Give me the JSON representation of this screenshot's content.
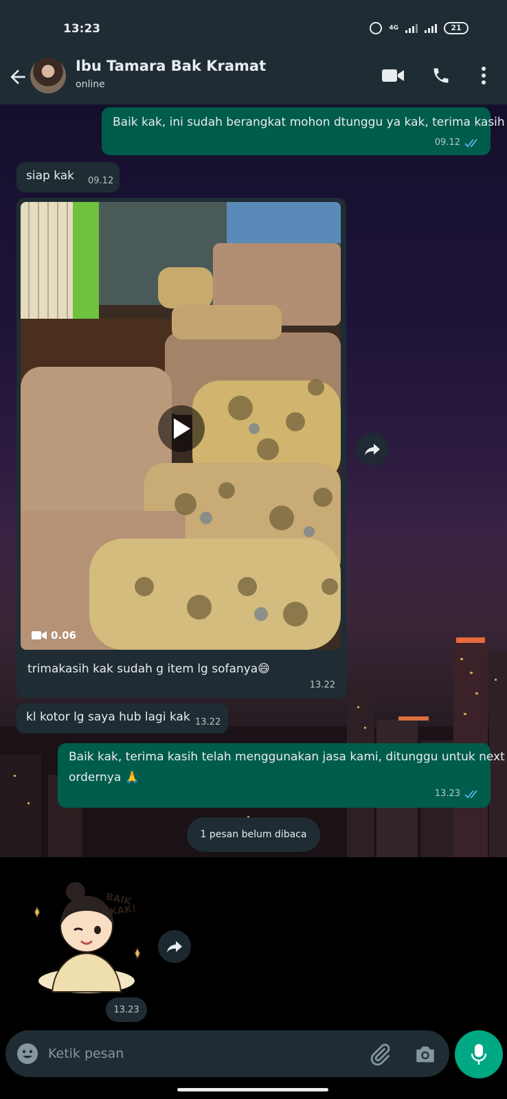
{
  "status_bar": {
    "time": "13:23",
    "network": "4G",
    "battery": "21"
  },
  "header": {
    "contact_name": "Ibu Tamara Bak Kramat",
    "contact_status": "online",
    "icons": [
      "back-arrow-icon",
      "video-call-icon",
      "voice-call-icon",
      "more-options-icon"
    ]
  },
  "messages": [
    {
      "direction": "out",
      "text": "Baik kak, ini sudah berangkat mohon dtunggu ya kak, terima kasih",
      "time": "09.12",
      "read": true
    },
    {
      "direction": "in",
      "text": "siap kak",
      "time": "09.12"
    },
    {
      "direction": "in",
      "type": "video",
      "duration": "0.06",
      "caption": "trimakasih kak sudah g item lg sofanya😄",
      "time": "13.22"
    },
    {
      "direction": "in",
      "text": "kl kotor lg saya hub lagi kak",
      "time": "13.22"
    },
    {
      "direction": "out",
      "text_line1": "Baik kak, terima kasih telah menggunakan jasa kami, ditunggu untuk next",
      "text_line2": "ordernya 🙏",
      "time": "13.23",
      "read": true
    },
    {
      "direction": "in",
      "type": "sticker",
      "sticker_text": "BAIK KAK!",
      "time": "13.23"
    }
  ],
  "unread_banner": "1 pesan belum dibaca",
  "composer": {
    "placeholder": "Ketik pesan"
  },
  "colors": {
    "outgoing": "#005c4b",
    "incoming": "#1f2c34",
    "accent": "#00a884",
    "read_ticks": "#53bdeb"
  }
}
